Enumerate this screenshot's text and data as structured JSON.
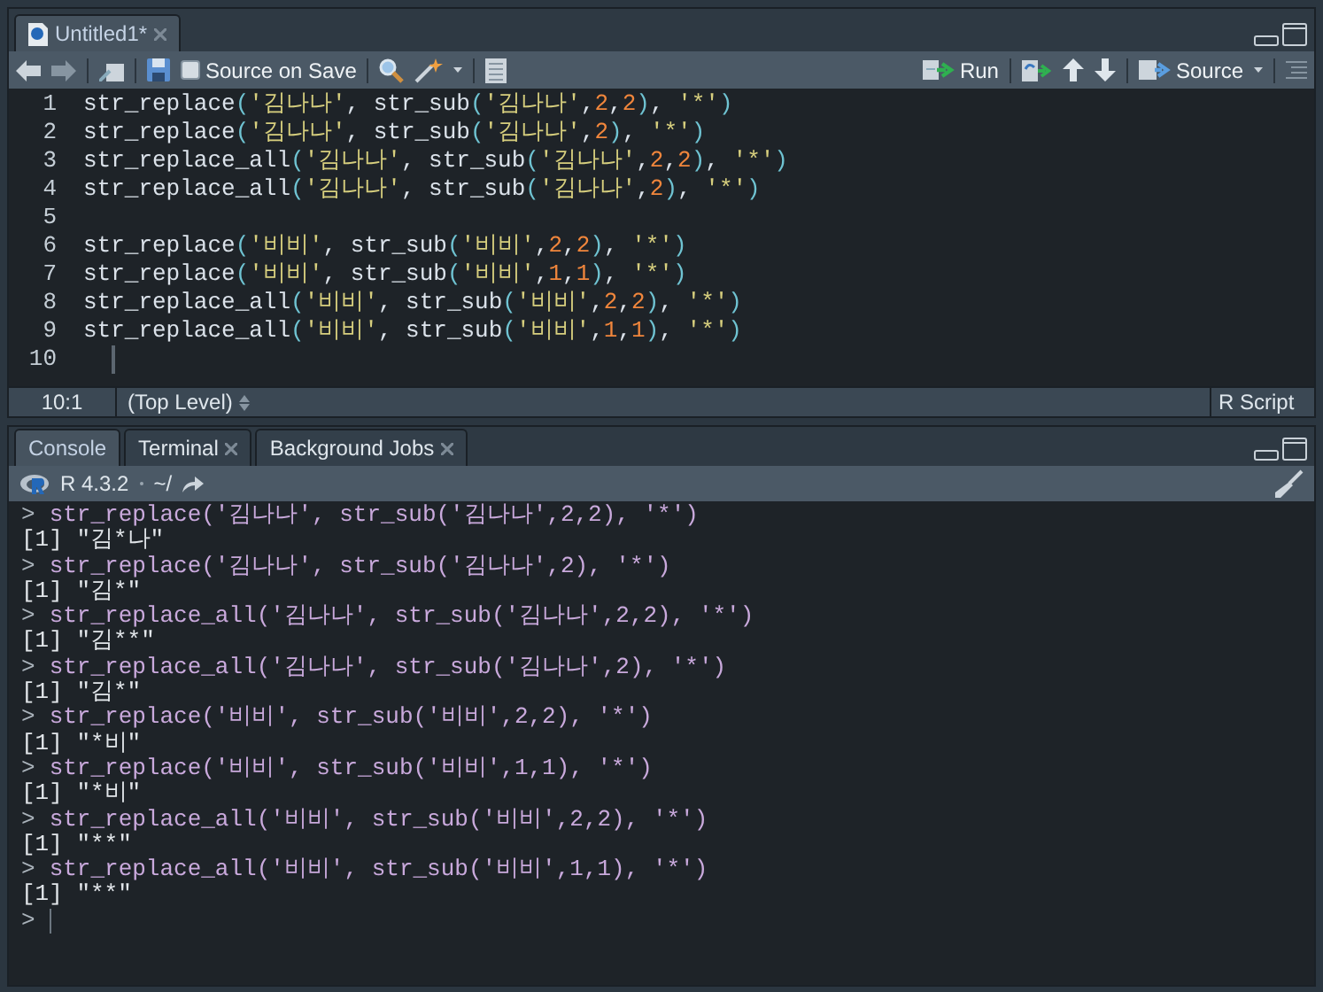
{
  "editor": {
    "tabs": [
      {
        "title": "Untitled1*",
        "selected": true
      }
    ],
    "toolbar": {
      "source_on_save": {
        "label": "Source on Save",
        "checked": false
      },
      "run_label": "Run",
      "source_label": "Source"
    },
    "code_lines": [
      {
        "number": "1",
        "text": "str_replace('김나나', str_sub('김나나',2,2), '*')"
      },
      {
        "number": "2",
        "text": "str_replace('김나나', str_sub('김나나',2), '*')"
      },
      {
        "number": "3",
        "text": "str_replace_all('김나나', str_sub('김나나',2,2), '*')"
      },
      {
        "number": "4",
        "text": "str_replace_all('김나나', str_sub('김나나',2), '*')"
      },
      {
        "number": "5"
      },
      {
        "number": "6",
        "text": "str_replace('비비', str_sub('비비',2,2), '*')"
      },
      {
        "number": "7",
        "text": "str_replace('비비', str_sub('비비',1,1), '*')"
      },
      {
        "number": "8",
        "text": "str_replace_all('비비', str_sub('비비',2,2), '*')"
      },
      {
        "number": "9",
        "text": "str_replace_all('비비', str_sub('비비',1,1), '*')"
      },
      {
        "number": "10",
        "cursor": true
      }
    ],
    "status": {
      "position": "10:1",
      "scope": "(Top Level)",
      "file_type": "R Script"
    }
  },
  "console": {
    "tabs": [
      {
        "label": "Console",
        "selected": true,
        "closable": false
      },
      {
        "label": "Terminal",
        "selected": false,
        "closable": true
      },
      {
        "label": "Background Jobs",
        "selected": false,
        "closable": true
      }
    ],
    "version": "R 4.3.2",
    "path": "~/",
    "lines": [
      {
        "kind": "input",
        "prompt": ">",
        "text": "str_replace('김나나', str_sub('김나나',2,2), '*')"
      },
      {
        "kind": "output",
        "text": "[1] \"김*나\""
      },
      {
        "kind": "input",
        "prompt": ">",
        "text": "str_replace('김나나', str_sub('김나나',2), '*')"
      },
      {
        "kind": "output",
        "text": "[1] \"김*\""
      },
      {
        "kind": "input",
        "prompt": ">",
        "text": "str_replace_all('김나나', str_sub('김나나',2,2), '*')"
      },
      {
        "kind": "output",
        "text": "[1] \"김**\""
      },
      {
        "kind": "input",
        "prompt": ">",
        "text": "str_replace_all('김나나', str_sub('김나나',2), '*')"
      },
      {
        "kind": "output",
        "text": "[1] \"김*\""
      },
      {
        "kind": "input",
        "prompt": ">",
        "text": "str_replace('비비', str_sub('비비',2,2), '*')"
      },
      {
        "kind": "output",
        "text": "[1] \"*비\""
      },
      {
        "kind": "input",
        "prompt": ">",
        "text": "str_replace('비비', str_sub('비비',1,1), '*')"
      },
      {
        "kind": "output",
        "text": "[1] \"*비\""
      },
      {
        "kind": "input",
        "prompt": ">",
        "text": "str_replace_all('비비', str_sub('비비',2,2), '*')"
      },
      {
        "kind": "output",
        "text": "[1] \"**\""
      },
      {
        "kind": "input",
        "prompt": ">",
        "text": "str_replace_all('비비', str_sub('비비',1,1), '*')"
      },
      {
        "kind": "output",
        "text": "[1] \"**\""
      },
      {
        "kind": "prompt",
        "prompt": ">",
        "cursor": true
      }
    ]
  }
}
